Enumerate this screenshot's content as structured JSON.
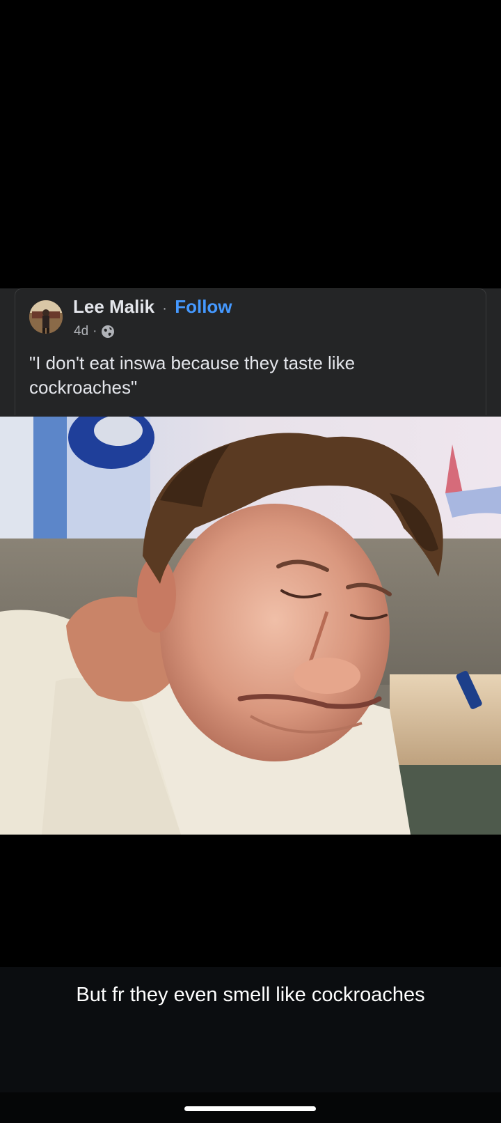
{
  "post": {
    "author": "Lee Malik",
    "separator": "·",
    "follow_label": "Follow",
    "timestamp": "4d",
    "meta_separator": "·",
    "audience_icon": "globe-icon",
    "text": "\"I don't eat inswa because they taste like cockroaches\""
  },
  "caption": {
    "text": "But fr they even smell like cockroaches"
  },
  "colors": {
    "card_bg": "#242526",
    "follow": "#4599ff",
    "caption_bg": "#0b0d10"
  }
}
